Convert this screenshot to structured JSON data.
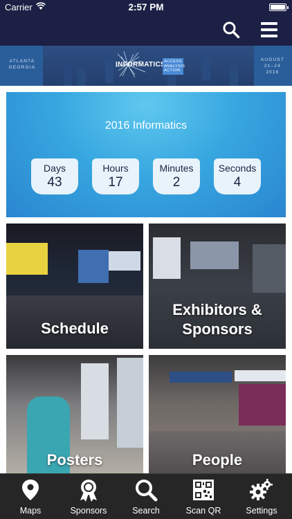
{
  "status_bar": {
    "carrier": "Carrier",
    "time": "2:57 PM"
  },
  "header": {
    "search_icon": "search-icon",
    "menu_icon": "menu-icon",
    "background": "#1c2045"
  },
  "banner": {
    "location_line1": "ATLANTA",
    "location_line2": "GEORGIA",
    "logo_text": "INFORMATICS",
    "tagline": [
      "ACCESS",
      "ANALYSIS",
      "ACTION"
    ],
    "dates_line1": "AUGUST",
    "dates_line2": "21–24",
    "dates_line3": "2016"
  },
  "countdown": {
    "title": "2016 Informatics",
    "units": [
      {
        "label": "Days",
        "value": "43"
      },
      {
        "label": "Hours",
        "value": "17"
      },
      {
        "label": "Minutes",
        "value": "2"
      },
      {
        "label": "Seconds",
        "value": "4"
      }
    ]
  },
  "tiles": [
    {
      "label": "Schedule"
    },
    {
      "label_line1": "Exhibitors &",
      "label_line2": "Sponsors"
    },
    {
      "label": "Posters"
    },
    {
      "label": "People"
    }
  ],
  "tabbar": {
    "tabs": [
      {
        "label": "Maps",
        "icon": "map-pin-icon"
      },
      {
        "label": "Sponsors",
        "icon": "ribbon-icon"
      },
      {
        "label": "Search",
        "icon": "search-icon"
      },
      {
        "label": "Scan QR",
        "icon": "qr-code-icon"
      },
      {
        "label": "Settings",
        "icon": "gears-icon"
      }
    ]
  },
  "colors": {
    "accent_blue": "#37a7e0",
    "tabbar": "#262626",
    "banner": "#1f3a68"
  }
}
